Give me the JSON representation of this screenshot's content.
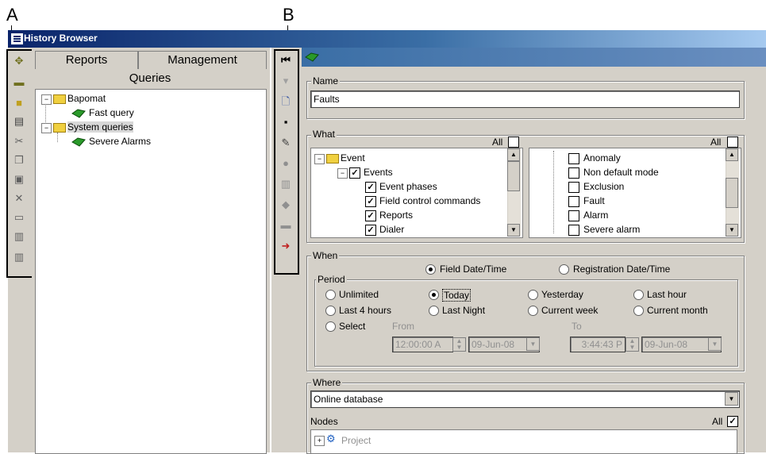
{
  "callouts": {
    "a": "A",
    "b": "B"
  },
  "window": {
    "title": "History Browser"
  },
  "left_toolbar": {
    "icons": [
      "tools-icon",
      "minus-icon",
      "folder-icon",
      "document-icon",
      "cut-icon",
      "copy-icon",
      "paste-icon",
      "delete-icon",
      "rename-icon",
      "export-icon",
      "import-icon"
    ]
  },
  "tabs": {
    "reports": "Reports",
    "management": "Management"
  },
  "queries_header": "Queries",
  "tree": {
    "bapomat": "Bapomat",
    "fast_query": "Fast query",
    "system_queries": "System queries",
    "severe_alarms": "Severe Alarms"
  },
  "form": {
    "name_group": "Name",
    "name_value": "Faults",
    "what_group": "What",
    "all": "All",
    "event_tree": {
      "event": "Event",
      "events": "Events",
      "items": [
        "Event phases",
        "Field control commands",
        "Reports",
        "Dialer"
      ]
    },
    "right_list": [
      "Anomaly",
      "Non default mode",
      "Exclusion",
      "Fault",
      "Alarm",
      "Severe alarm"
    ],
    "when_group": "When",
    "field_dt": "Field Date/Time",
    "registration_dt": "Registration Date/Time",
    "period_group": "Period",
    "period": {
      "unlimited": "Unlimited",
      "today": "Today",
      "yesterday": "Yesterday",
      "last_hour": "Last hour",
      "last4": "Last 4 hours",
      "last_night": "Last Night",
      "current_week": "Current week",
      "current_month": "Current month",
      "select": "Select"
    },
    "from": "From",
    "to": "To",
    "from_time": "12:00:00 A",
    "from_date": "09-Jun-08",
    "to_time": "3:44:43 P",
    "to_date": "09-Jun-08",
    "where_group": "Where",
    "where_value": "Online database",
    "nodes": "Nodes",
    "project": "Project"
  }
}
